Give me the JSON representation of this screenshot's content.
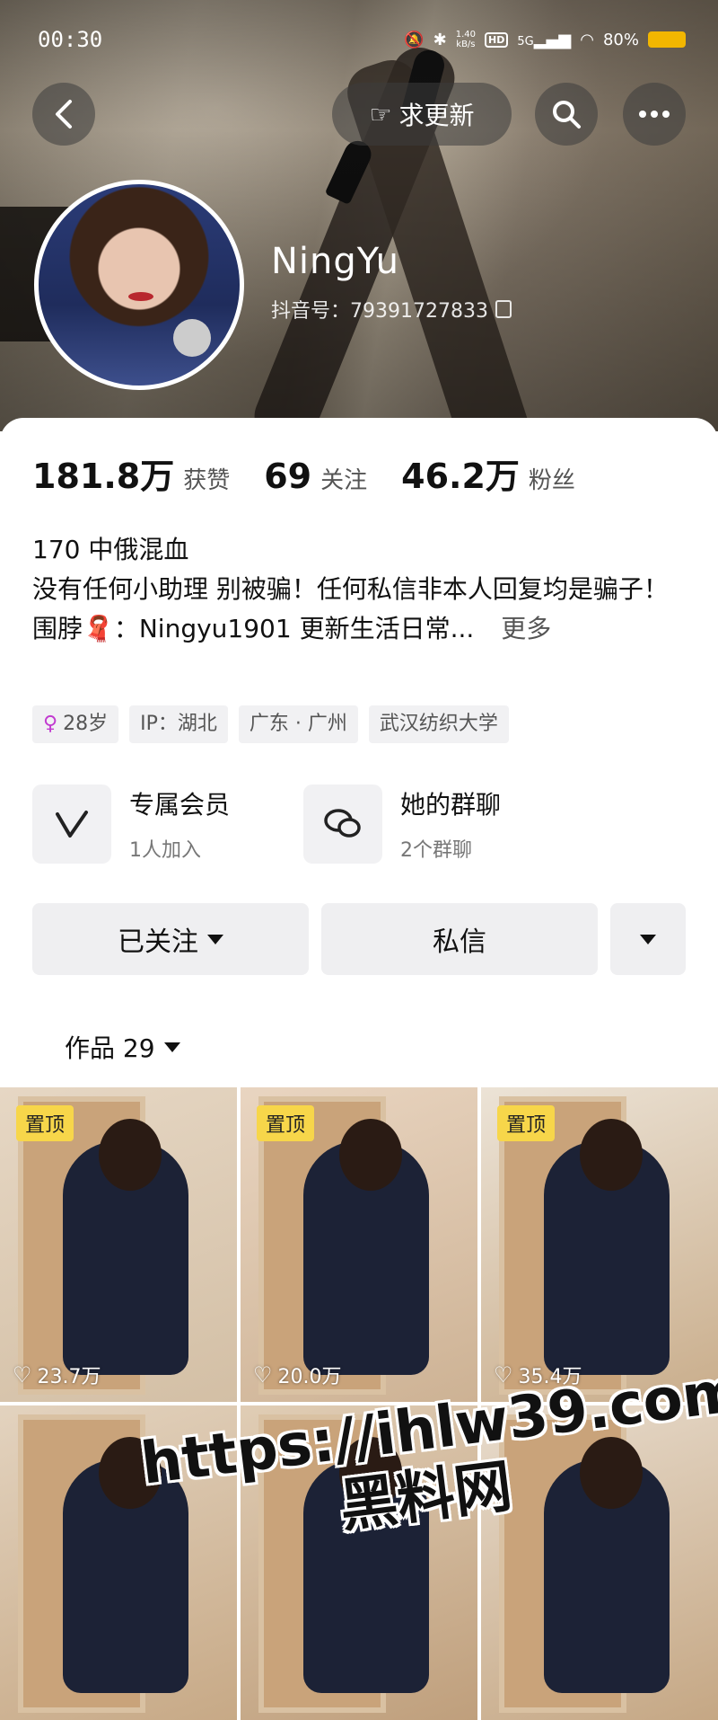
{
  "status_bar": {
    "time": "00:30",
    "net_speed": "1.40",
    "net_unit": "kB/s",
    "hd": "HD",
    "signal": "5G",
    "battery": "80%"
  },
  "header": {
    "request_update_label": "求更新"
  },
  "profile": {
    "name": "NingYu",
    "douyin_id": "抖音号：79391727833"
  },
  "stats": [
    {
      "value": "181.8万",
      "label": "获赞"
    },
    {
      "value": "69",
      "label": "关注"
    },
    {
      "value": "46.2万",
      "label": "粉丝"
    }
  ],
  "bio": {
    "line1": "170 中俄混血",
    "line2": "没有任何小助理 别被骗！任何私信非本人回复均是骗子！",
    "line3": "围脖🧣：Ningyu1901  更新生活日常...",
    "more": "更多"
  },
  "tags": {
    "age": "28岁",
    "age_icon": "♀",
    "ip": "IP：湖北",
    "location": "广东 · 广州",
    "school": "武汉纺织大学"
  },
  "features": {
    "member": {
      "title": "专属会员",
      "subtitle": "1人加入",
      "icon": "v-logo-icon"
    },
    "group": {
      "title": "她的群聊",
      "subtitle": "2个群聊",
      "icon": "chat-bubbles-icon"
    }
  },
  "actions": {
    "following": "已关注",
    "message": "私信"
  },
  "works": {
    "label": "作品 29"
  },
  "grid": {
    "pin_label": "置顶",
    "items": [
      {
        "likes": "23.7万",
        "pinned": true
      },
      {
        "likes": "20.0万",
        "pinned": true
      },
      {
        "likes": "35.4万",
        "pinned": true
      },
      {
        "likes": "",
        "pinned": false
      },
      {
        "likes": "",
        "pinned": false
      },
      {
        "likes": "",
        "pinned": false
      }
    ]
  },
  "watermark": {
    "line1": "https://ihlw39.com",
    "line2": "黑料网"
  }
}
